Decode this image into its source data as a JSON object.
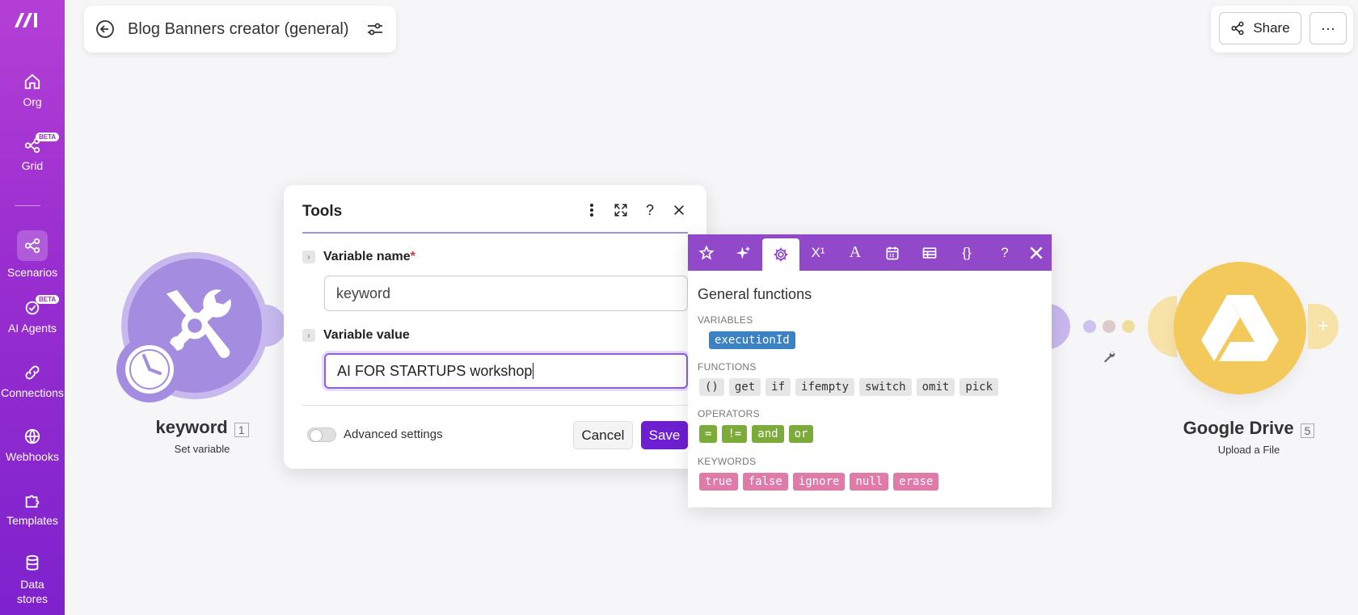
{
  "sidebar": {
    "items": [
      {
        "label": "Org",
        "icon": "home-icon"
      },
      {
        "label": "Grid",
        "icon": "grid-icon",
        "badge": "BETA"
      },
      {
        "label": "Scenarios",
        "icon": "share-nodes-icon"
      },
      {
        "label": "AI Agents",
        "icon": "ai-agents-icon",
        "badge": "BETA"
      },
      {
        "label": "Connections",
        "icon": "link-icon"
      },
      {
        "label": "Webhooks",
        "icon": "globe-icon"
      },
      {
        "label": "Templates",
        "icon": "puzzle-icon"
      },
      {
        "label": "Data stores",
        "icon": "database-icon"
      }
    ]
  },
  "header": {
    "title": "Blog Banners creator (general)",
    "share_label": "Share",
    "more_label": "···"
  },
  "modules": {
    "left": {
      "name": "keyword",
      "number": "1",
      "subtitle": "Set variable"
    },
    "right": {
      "name": "Google Drive",
      "number": "5",
      "subtitle": "Upload a File"
    }
  },
  "dialog": {
    "title": "Tools",
    "field1_label": "Variable name",
    "required_mark": "*",
    "field1_value": "keyword",
    "field2_label": "Variable value",
    "field2_value": "AI FOR STARTUPS workshop",
    "advanced_label": "Advanced settings",
    "cancel_label": "Cancel",
    "save_label": "Save",
    "help_label": "?"
  },
  "functions_panel": {
    "heading": "General functions",
    "superscript_tab": "X¹",
    "text_tab": "A",
    "json_tab": "{}",
    "help_tab": "?",
    "sections": {
      "variables": {
        "title": "VARIABLES",
        "items": [
          "executionId"
        ]
      },
      "functions": {
        "title": "FUNCTIONS",
        "items": [
          "()",
          "get",
          "if",
          "ifempty",
          "switch",
          "omit",
          "pick"
        ]
      },
      "operators": {
        "title": "OPERATORS",
        "items": [
          "=",
          "!=",
          "and",
          "or"
        ]
      },
      "keywords": {
        "title": "KEYWORDS",
        "items": [
          "true",
          "false",
          "ignore",
          "null",
          "erase"
        ]
      }
    }
  },
  "colors": {
    "brand": "#9b2fd0",
    "save": "#6d1fd1",
    "tools_module": "#a48ce0",
    "drive_module": "#f3c95b"
  }
}
